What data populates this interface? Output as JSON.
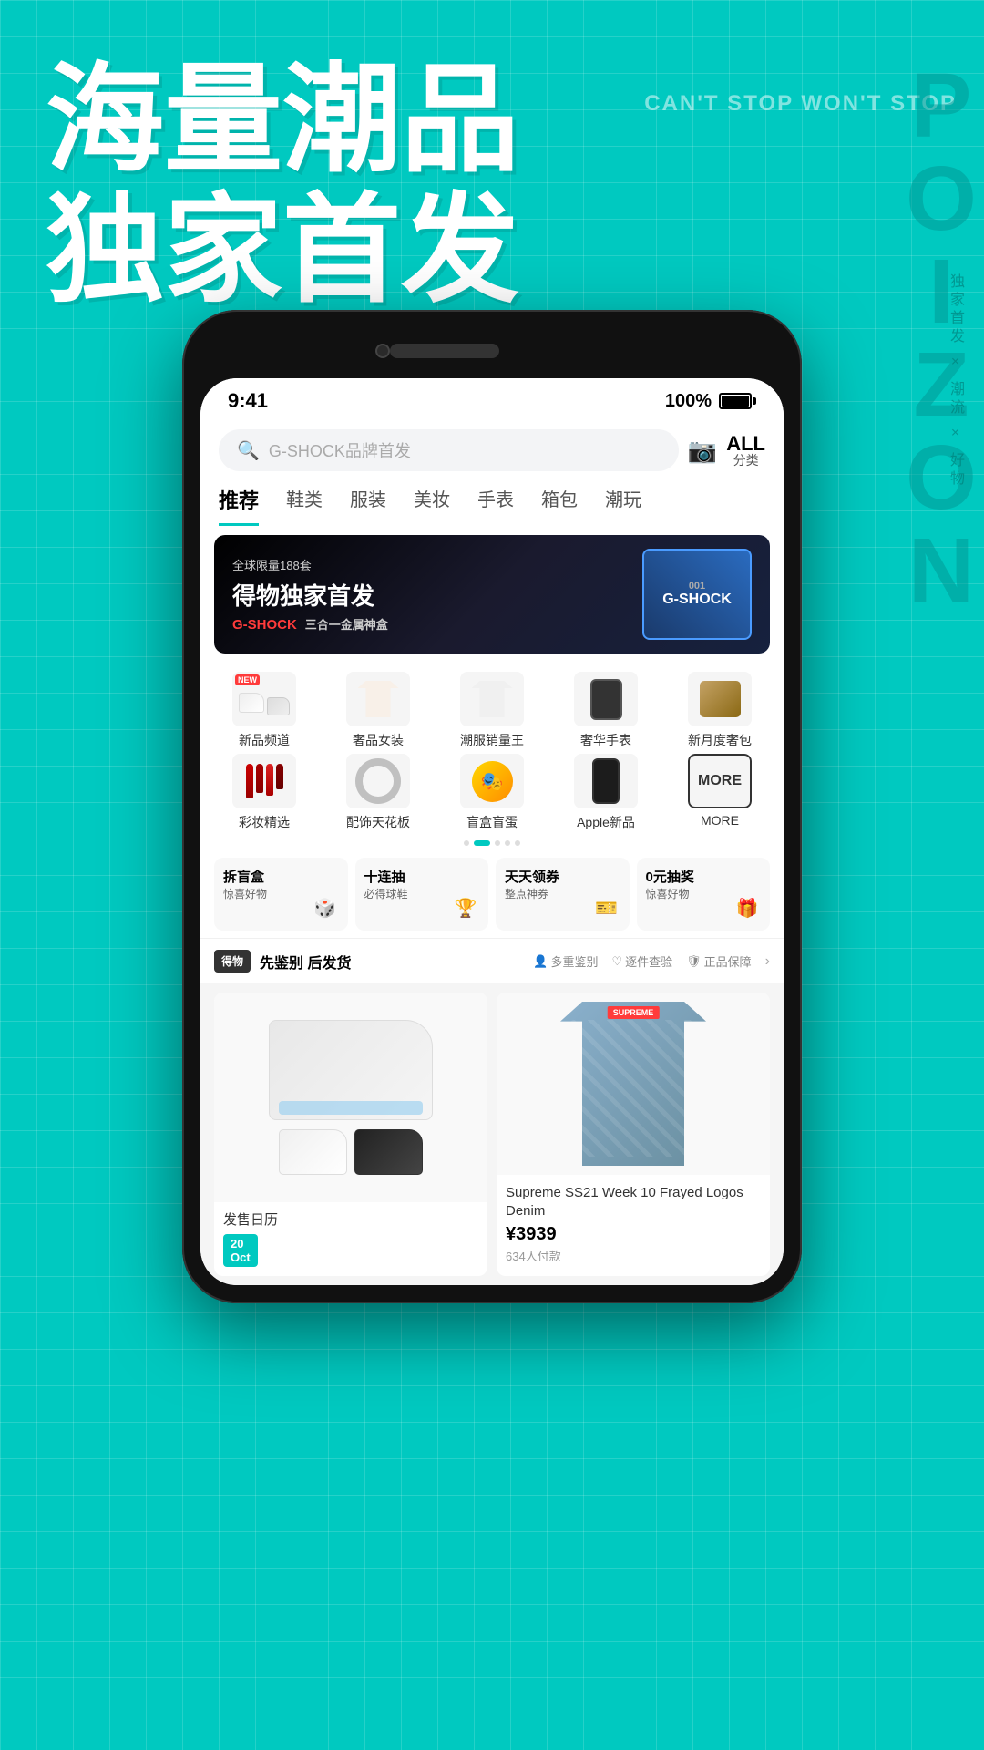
{
  "app": {
    "name": "POIZON",
    "slogan": "CAN'T STOP WON'T STOP",
    "brand_vertical": "POIZON",
    "brand_sub_vertical": "独家首发 × 潮流 × 好物"
  },
  "hero": {
    "line1": "海量潮品",
    "line2": "独家首发"
  },
  "status_bar": {
    "time": "9:41",
    "battery": "100%"
  },
  "search": {
    "placeholder": "G-SHOCK品牌首发",
    "camera_label": "相机",
    "all_label": "ALL",
    "fen_lei": "分类"
  },
  "categories": [
    {
      "id": "recommend",
      "label": "推荐",
      "active": true
    },
    {
      "id": "shoes",
      "label": "鞋类",
      "active": false
    },
    {
      "id": "clothing",
      "label": "服装",
      "active": false
    },
    {
      "id": "beauty",
      "label": "美妆",
      "active": false
    },
    {
      "id": "watch",
      "label": "手表",
      "active": false
    },
    {
      "id": "bag",
      "label": "箱包",
      "active": false
    },
    {
      "id": "trend",
      "label": "潮玩",
      "active": false
    }
  ],
  "banner": {
    "tag": "全球限量188套",
    "title": "得物独家首发",
    "subtitle_brand": "G-SHOCK",
    "subtitle_desc": "三合一金属神盒",
    "box_label": "G-SHOCK"
  },
  "icon_grid": {
    "row1": [
      {
        "id": "new-products",
        "label": "新品频道",
        "badge": "NEW"
      },
      {
        "id": "luxury-women",
        "label": "奢品女装",
        "badge": ""
      },
      {
        "id": "trend-clothing",
        "label": "潮服销量王",
        "badge": ""
      },
      {
        "id": "luxury-watch",
        "label": "奢华手表",
        "badge": ""
      },
      {
        "id": "new-bag",
        "label": "新月度奢包",
        "badge": ""
      }
    ],
    "row2": [
      {
        "id": "makeup",
        "label": "彩妆精选",
        "badge": ""
      },
      {
        "id": "accessories",
        "label": "配饰天花板",
        "badge": ""
      },
      {
        "id": "blind-box",
        "label": "盲盒盲蛋",
        "badge": ""
      },
      {
        "id": "apple",
        "label": "Apple新品",
        "badge": ""
      },
      {
        "id": "more",
        "label": "MORE",
        "badge": ""
      }
    ]
  },
  "promo_cards": [
    {
      "id": "blind-box-open",
      "title": "拆盲盒",
      "sub": "惊喜好物",
      "emoji": "🎲"
    },
    {
      "id": "ten-draw",
      "title": "十连抽",
      "sub": "必得球鞋",
      "emoji": "🏆"
    },
    {
      "id": "daily-coupon",
      "title": "天天领券",
      "sub": "整点神券",
      "emoji": "🎫"
    },
    {
      "id": "free-draw",
      "title": "0元抽奖",
      "sub": "惊喜好物",
      "emoji": "🎁"
    }
  ],
  "auth_strip": {
    "logo": "得物",
    "title": "先鉴别 后发货",
    "items": [
      "多重鉴别",
      "逐件查验",
      "正品保障"
    ]
  },
  "products": [
    {
      "id": "shoe1",
      "name": "发售日历",
      "price": "",
      "sold": "",
      "date": "20 Oct"
    },
    {
      "id": "jacket1",
      "name": "Supreme SS21 Week 10 Frayed Logos Denim",
      "price": "¥3939",
      "sold": "634人付款"
    }
  ],
  "dots": [
    false,
    true,
    false,
    false,
    false
  ],
  "colors": {
    "brand": "#00C9C0",
    "accent_red": "#FF3B3B",
    "black": "#111111",
    "white": "#FFFFFF"
  }
}
